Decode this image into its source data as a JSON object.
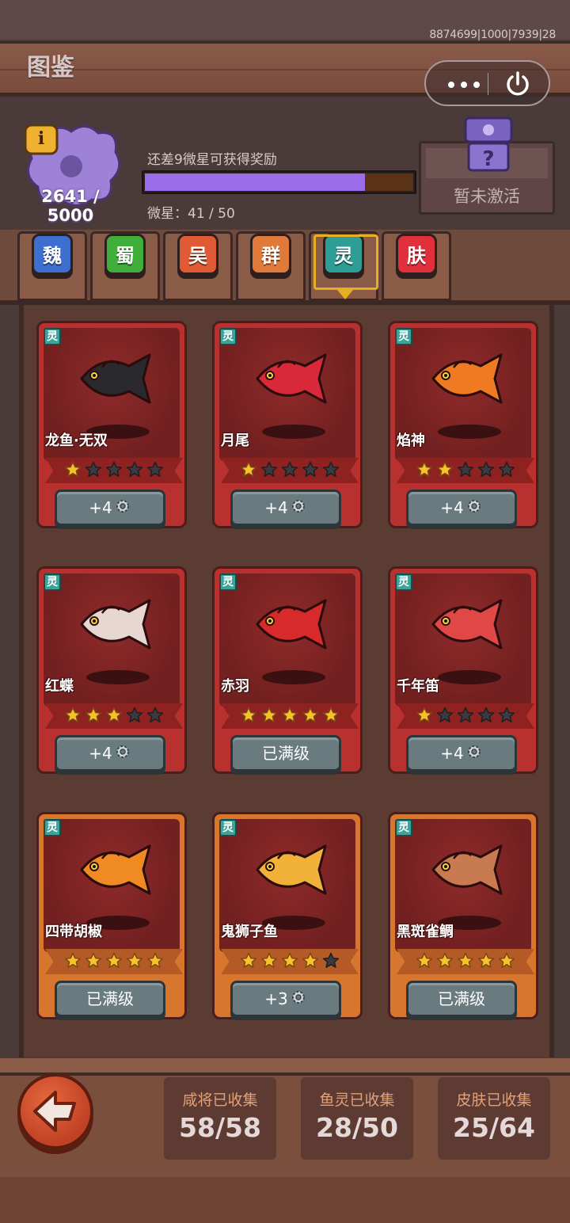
{
  "debug_id": "8874699|1000|7939|28",
  "page_title": "图鉴",
  "capsule": {
    "more_icon": "more-dots-icon",
    "close_icon": "power-icon"
  },
  "collection_progress": {
    "current": 2641,
    "max": 5000,
    "text": "2641 / 5000",
    "info_icon": "info-icon"
  },
  "reward_hint": "还差9微星可获得奖励",
  "micro_stars": {
    "label": "微星：41 / 50",
    "current": 41,
    "max": 50,
    "fill_fraction": 0.82
  },
  "locked_reward": {
    "label": "暂未激活",
    "icon": "mystery-box-icon"
  },
  "tabs": [
    {
      "label": "魏",
      "color": "#3d6fd0"
    },
    {
      "label": "蜀",
      "color": "#3fae3b"
    },
    {
      "label": "吴",
      "color": "#e05a35"
    },
    {
      "label": "群",
      "color": "#e07a3a"
    },
    {
      "label": "灵",
      "color": "#2d9d96",
      "selected": true
    },
    {
      "label": "肤",
      "color": "#e0303c"
    }
  ],
  "cards": [
    {
      "tag": "灵",
      "name": "龙鱼·无双",
      "stars": 1,
      "max_stars": 5,
      "button": "+4",
      "button_icon": "gear-icon",
      "frame": "red",
      "fish_color": "#2a2a2e"
    },
    {
      "tag": "灵",
      "name": "月尾",
      "stars": 1,
      "max_stars": 5,
      "button": "+4",
      "button_icon": "gear-icon",
      "frame": "red",
      "fish_color": "#d8283a"
    },
    {
      "tag": "灵",
      "name": "焰神",
      "stars": 2,
      "max_stars": 5,
      "button": "+4",
      "button_icon": "gear-icon",
      "frame": "red",
      "fish_color": "#f07a22"
    },
    {
      "tag": "灵",
      "name": "红蝶",
      "stars": 3,
      "max_stars": 5,
      "button": "+4",
      "button_icon": "gear-icon",
      "frame": "red",
      "fish_color": "#e8d6d0"
    },
    {
      "tag": "灵",
      "name": "赤羽",
      "stars": 5,
      "max_stars": 5,
      "button": "已满级",
      "button_icon": "",
      "frame": "red",
      "fish_color": "#d82a2a"
    },
    {
      "tag": "灵",
      "name": "千年笛",
      "stars": 1,
      "max_stars": 5,
      "button": "+4",
      "button_icon": "gear-icon",
      "frame": "red",
      "fish_color": "#e04848"
    },
    {
      "tag": "灵",
      "name": "四带胡椒",
      "stars": 5,
      "max_stars": 5,
      "button": "已满级",
      "button_icon": "",
      "frame": "orange",
      "fish_color": "#f08a22"
    },
    {
      "tag": "灵",
      "name": "鬼狮子鱼",
      "stars": 4,
      "max_stars": 5,
      "button": "+3",
      "button_icon": "gear-icon",
      "frame": "orange",
      "fish_color": "#f2b23a"
    },
    {
      "tag": "灵",
      "name": "黑斑雀鲷",
      "stars": 5,
      "max_stars": 5,
      "button": "已满级",
      "button_icon": "",
      "frame": "orange",
      "fish_color": "#c87a50"
    }
  ],
  "back_button_icon": "back-arrow-icon",
  "stats": [
    {
      "label": "咸将已收集",
      "value": "58/58"
    },
    {
      "label": "鱼灵已收集",
      "value": "28/50"
    },
    {
      "label": "皮肤已收集",
      "value": "25/64"
    }
  ]
}
